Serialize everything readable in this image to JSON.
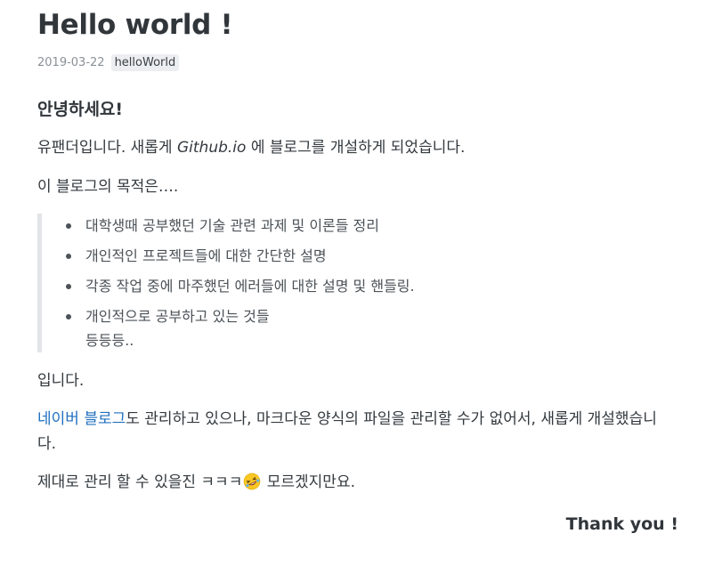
{
  "post": {
    "title": "Hello world !",
    "date": "2019-03-22",
    "tag": "helloWorld",
    "greeting": "안녕하세요!",
    "intro": {
      "before": "유팬더입니다. 새롭게 ",
      "italic": "Github.io",
      "after": " 에 블로그를 개설하게 되었습니다."
    },
    "purpose": "이 블로그의 목적은….",
    "list_items": [
      "대학생때 공부했던 기술 관련 과제 및 이론들 정리",
      "개인적인 프로젝트들에 대한 간단한 설명",
      "각종 작업 중에 마주했던 에러들에 대한 설명 및 핸들링.",
      "개인적으로 공부하고 있는 것들",
      "등등등.."
    ],
    "closing": "입니다.",
    "naver": {
      "link_text": "네이버 블로그",
      "text_line1": "도 관리하고 있으나, 마크다운 양식의 파일을 관리할 수가 없어서, 새롭게 개설했습니",
      "text_line2": "다."
    },
    "manage": {
      "before": "제대로 관리 할 수 있을진 ㅋㅋㅋ",
      "emoji": "rolling-on-floor-laughing-emoji",
      "after": " 모르겠지만요."
    },
    "thanks": "Thank you !"
  },
  "colors": {
    "link": "#1f6fbf",
    "text": "#33393e",
    "tag_bg": "#eceef1",
    "quote_border": "#e2e4e7"
  }
}
